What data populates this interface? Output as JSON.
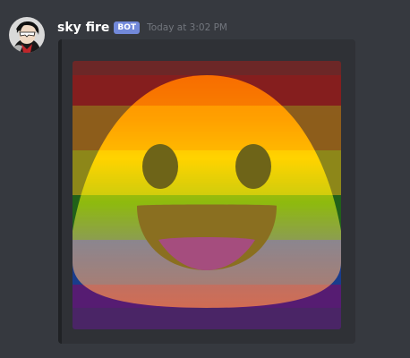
{
  "message": {
    "author": "sky fire",
    "bot_tag": "BOT",
    "timestamp": "Today at 3:02 PM"
  },
  "avatar": {
    "icon": "masked-character-avatar"
  },
  "embed": {
    "image_icon": "grinning-blob-emoji-rainbow-flag",
    "accent_color": "#202225",
    "flag_stripe_colors": [
      "#6c2727",
      "#6d5024",
      "#6d6a21",
      "#2b5021",
      "#213b6c",
      "#4a2566"
    ],
    "emoji_gradient": [
      "#ff8c00",
      "#ffcc00",
      "#b7c214",
      "#b59a6e",
      "#e88c3e"
    ]
  },
  "colors": {
    "background": "#36393f",
    "embed_background": "#2f3136",
    "username": "#ffffff",
    "bot_tag_background": "#7289da",
    "timestamp": "#72767d"
  }
}
